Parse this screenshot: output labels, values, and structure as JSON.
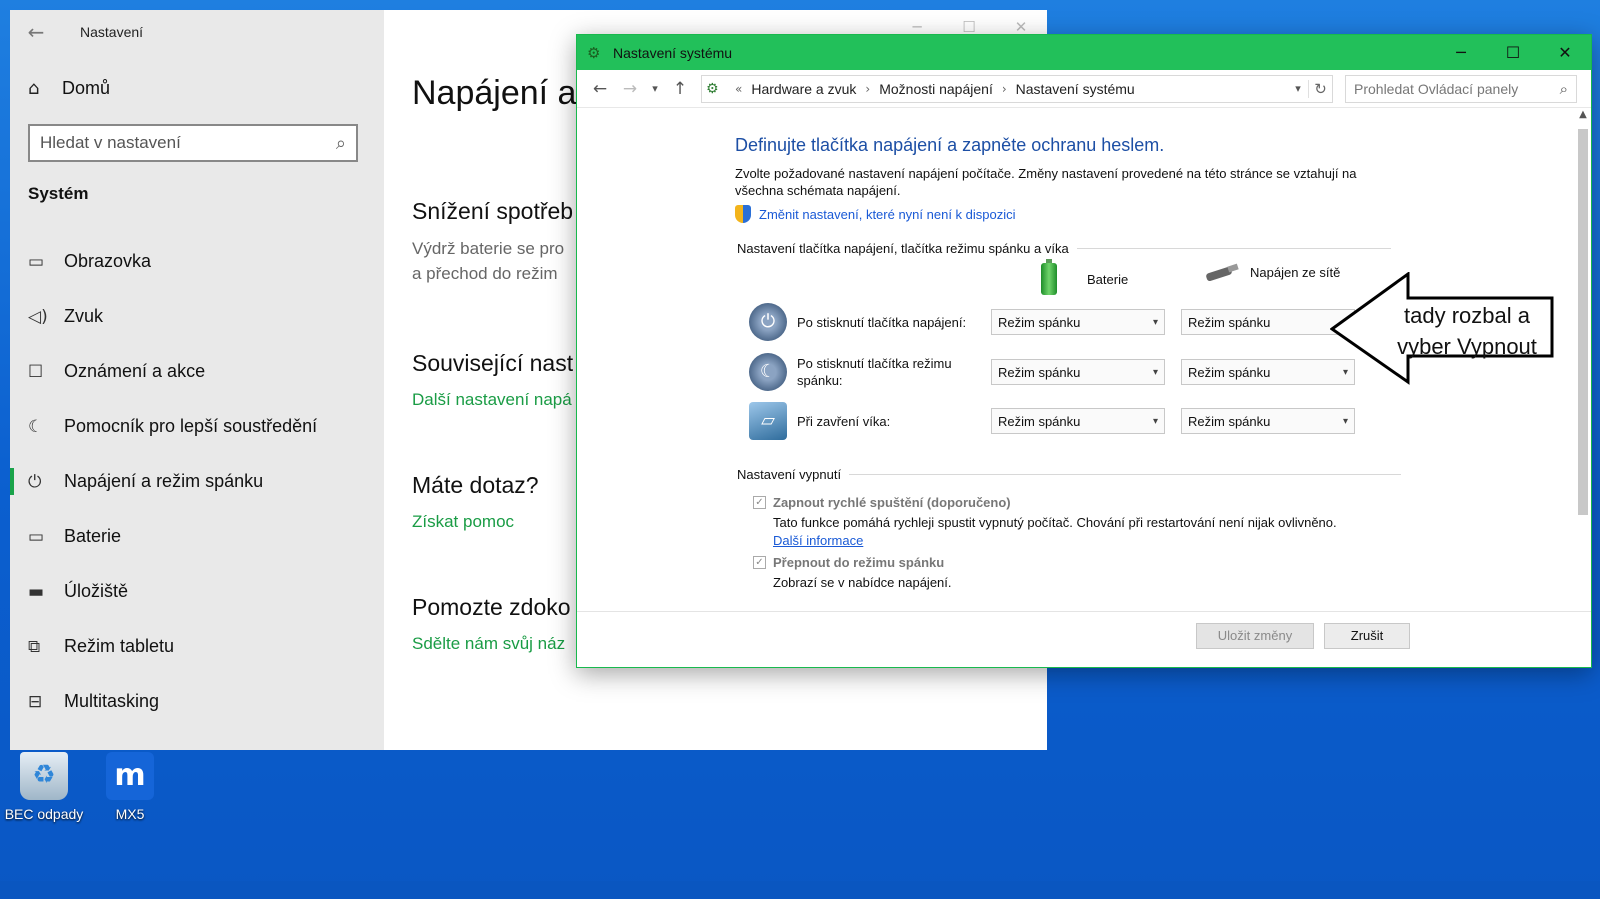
{
  "desktop": {
    "icons": [
      {
        "label": "BEC odpady",
        "icon": "recycle-bin-icon"
      },
      {
        "label": "MX5",
        "icon": "mx5-app-icon"
      }
    ]
  },
  "settings": {
    "title": "Nastavení",
    "home": "Domů",
    "search_placeholder": "Hledat v nastavení",
    "section": "Systém",
    "nav": [
      {
        "label": "Obrazovka",
        "icon": "monitor-icon"
      },
      {
        "label": "Zvuk",
        "icon": "speaker-icon"
      },
      {
        "label": "Oznámení a akce",
        "icon": "notification-icon"
      },
      {
        "label": "Pomocník pro lepší soustředění",
        "icon": "moon-icon"
      },
      {
        "label": "Napájení a režim spánku",
        "icon": "power-icon",
        "active": true
      },
      {
        "label": "Baterie",
        "icon": "battery-icon"
      },
      {
        "label": "Úložiště",
        "icon": "storage-icon"
      },
      {
        "label": "Režim tabletu",
        "icon": "tablet-icon"
      },
      {
        "label": "Multitasking",
        "icon": "multitasking-icon"
      }
    ],
    "main": {
      "heading": "Napájení a",
      "reduce_title": "Snížení spotřeb",
      "reduce_text_1": "Výdrž baterie se pro",
      "reduce_text_2": "a přechod do režim",
      "related_title": "Související nast",
      "related_link": "Další nastavení napá",
      "question_title": "Máte dotaz?",
      "question_link": "Získat pomoc",
      "help_title": "Pomozte zdoko",
      "help_link": "Sdělte nám svůj náz"
    }
  },
  "control_panel": {
    "title": "Nastavení systému",
    "breadcrumb": {
      "prefix": "«",
      "items": [
        "Hardware a zvuk",
        "Možnosti napájení",
        "Nastavení systému"
      ]
    },
    "search_placeholder": "Prohledat Ovládací panely",
    "heading": "Definujte tlačítka napájení a zapněte ochranu heslem.",
    "description": "Zvolte požadované nastavení napájení počítače. Změny nastavení provedené na této stránce se vztahují na všechna schémata napájení.",
    "change_link": "Změnit nastavení, které nyní není k dispozici",
    "group_buttons": "Nastavení tlačítka napájení, tlačítka režimu spánku a víka",
    "col_battery": "Baterie",
    "col_ac": "Napájen ze sítě",
    "rows": [
      {
        "label": "Po stisknutí tlačítka napájení:",
        "battery": "Režim spánku",
        "ac": "Režim spánku",
        "icon": "power-button-icon"
      },
      {
        "label": "Po stisknutí tlačítka režimu spánku:",
        "battery": "Režim spánku",
        "ac": "Režim spánku",
        "icon": "sleep-button-icon"
      },
      {
        "label": "Při zavření víka:",
        "battery": "Režim spánku",
        "ac": "Režim spánku",
        "icon": "laptop-lid-icon"
      }
    ],
    "group_shutdown": "Nastavení vypnutí",
    "fast_startup_label": "Zapnout rychlé spuštění (doporučeno)",
    "fast_startup_desc": "Tato funkce pomáhá rychleji spustit vypnutý počítač. Chování při restartování není nijak ovlivněno.",
    "more_info_link": "Další informace",
    "sleep_label": "Přepnout do režimu spánku",
    "sleep_desc": "Zobrazí se v nabídce napájení.",
    "save_button": "Uložit změny",
    "cancel_button": "Zrušit"
  },
  "annotation": {
    "line1": "tady rozbal a",
    "line2": "vyber Vypnout"
  }
}
